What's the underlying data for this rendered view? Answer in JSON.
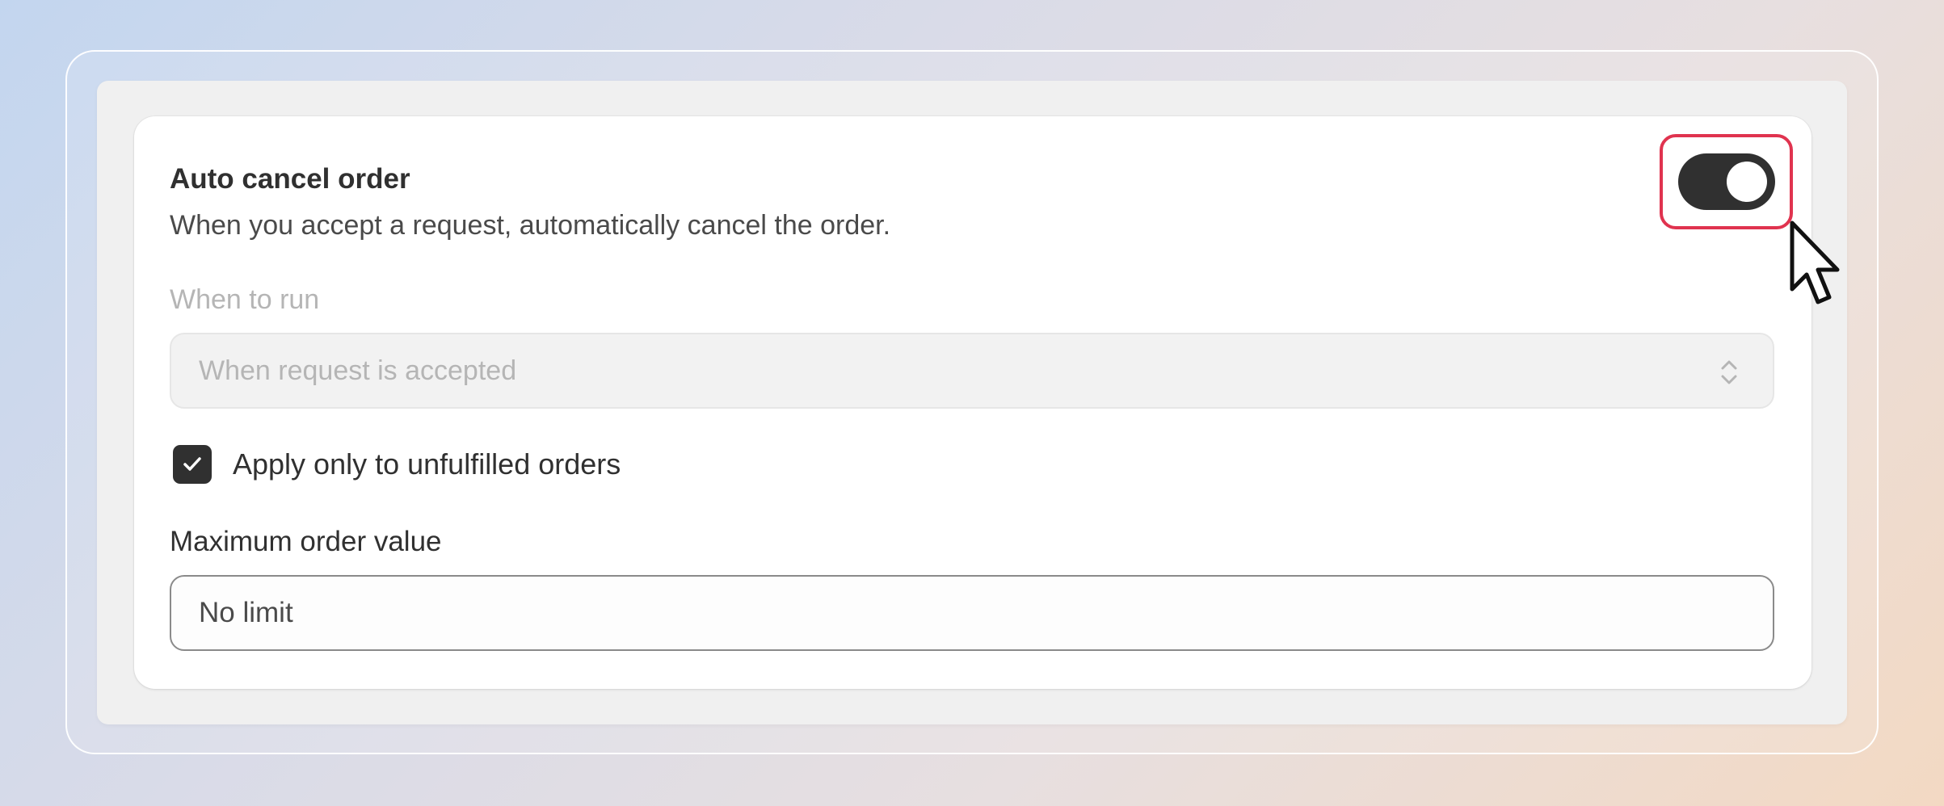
{
  "setting": {
    "title": "Auto cancel order",
    "description": "When you accept a request, automatically cancel the order.",
    "toggle_on": true
  },
  "when_to_run": {
    "label": "When to run",
    "selected": "When request is accepted",
    "disabled": true
  },
  "unfulfilled": {
    "label": "Apply only to unfulfilled orders",
    "checked": true
  },
  "max_order_value": {
    "label": "Maximum order value",
    "placeholder": "No limit"
  },
  "colors": {
    "toggle_active": "#303030",
    "highlight": "#e0334f"
  }
}
